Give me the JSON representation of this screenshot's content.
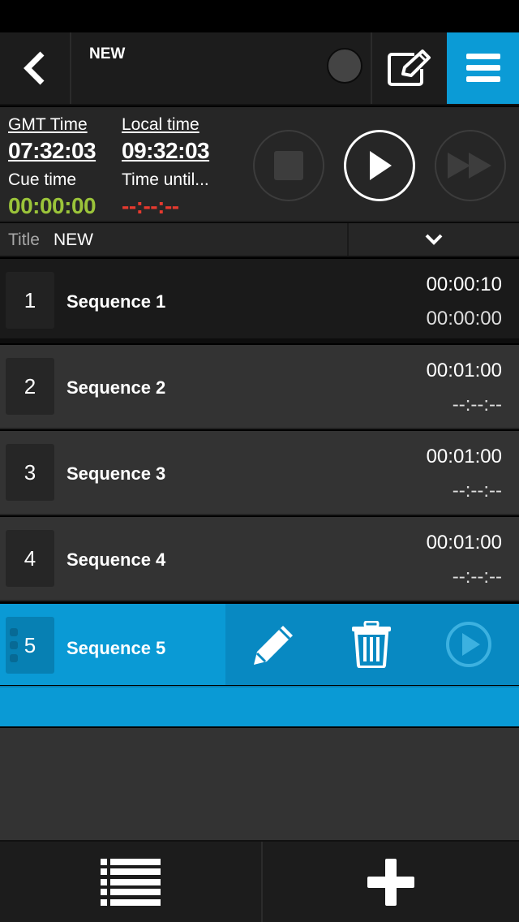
{
  "header": {
    "title": "NEW"
  },
  "time_panel": {
    "gmt_label": "GMT Time",
    "gmt_value": "07:32:03",
    "local_label": "Local time",
    "local_value": "09:32:03",
    "cue_label": "Cue time",
    "cue_value": "00:00:00",
    "until_label": "Time until...",
    "until_value": "--:--:--"
  },
  "title_row": {
    "label": "Title",
    "value": "NEW"
  },
  "sequences": [
    {
      "num": "1",
      "name": "Sequence 1",
      "t1": "00:00:10",
      "t2": "00:00:00"
    },
    {
      "num": "2",
      "name": "Sequence 2",
      "t1": "00:01:00",
      "t2": "--:--:--"
    },
    {
      "num": "3",
      "name": "Sequence 3",
      "t1": "00:01:00",
      "t2": "--:--:--"
    },
    {
      "num": "4",
      "name": "Sequence 4",
      "t1": "00:01:00",
      "t2": "--:--:--"
    },
    {
      "num": "5",
      "name": "Sequence 5"
    }
  ],
  "colors": {
    "accent": "#0b9bd6",
    "cue_green": "#9bc43a",
    "until_red": "#e53a2f"
  },
  "icons": [
    "back-icon",
    "record-icon",
    "edit-icon",
    "menu-icon",
    "stop-icon",
    "play-icon",
    "fast-forward-icon",
    "chevron-down-icon",
    "pencil-icon",
    "trash-icon",
    "play-circle-icon",
    "list-icon",
    "plus-icon"
  ]
}
